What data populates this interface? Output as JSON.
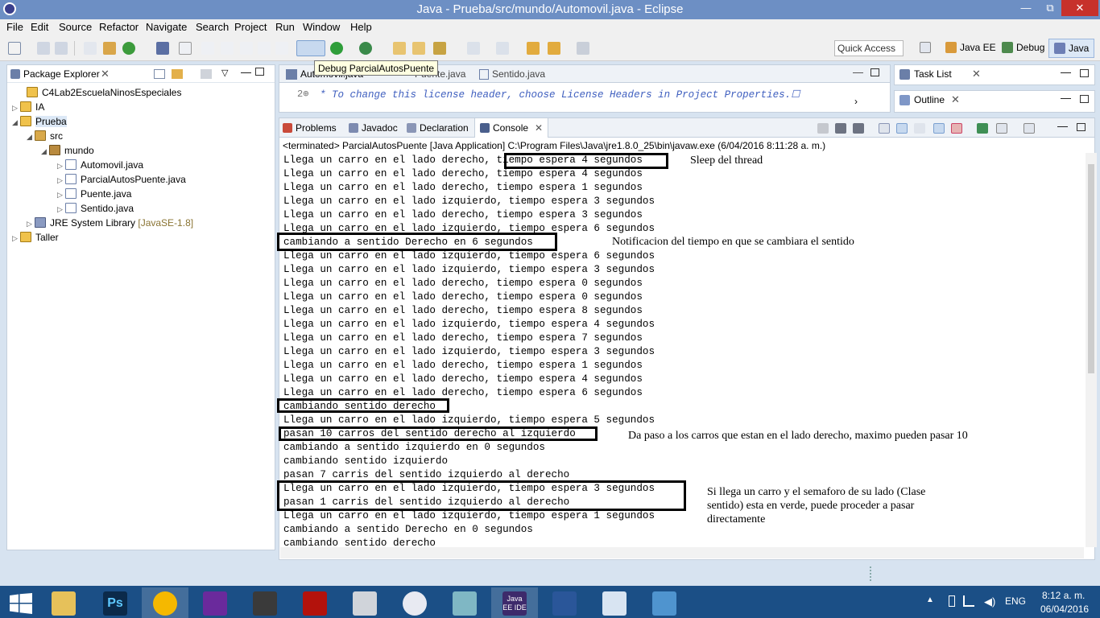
{
  "window": {
    "title": "Java - Prueba/src/mundo/Automovil.java - Eclipse",
    "min": "—",
    "max": "⧉",
    "close": "✕"
  },
  "menu": [
    "File",
    "Edit",
    "Source",
    "Refactor",
    "Navigate",
    "Search",
    "Project",
    "Run",
    "Window",
    "Help"
  ],
  "toolbar": {
    "quick_access": "Quick Access",
    "tooltip": "Debug ParcialAutosPuente",
    "perspectives": [
      "Java EE",
      "Debug",
      "Java"
    ]
  },
  "package_explorer": {
    "title": "Package Explorer",
    "items": [
      {
        "label": "C4Lab2EscuelaNinosEspeciales",
        "icon": "project-icon"
      },
      {
        "label": "IA",
        "icon": "project-icon"
      },
      {
        "label": "Prueba",
        "icon": "project-icon"
      },
      {
        "label": "src",
        "icon": "source-folder-icon"
      },
      {
        "label": "mundo",
        "icon": "package-icon"
      },
      {
        "label": "Automovil.java",
        "icon": "java-file-icon"
      },
      {
        "label": "ParcialAutosPuente.java",
        "icon": "java-file-icon"
      },
      {
        "label": "Puente.java",
        "icon": "java-file-icon"
      },
      {
        "label": "Sentido.java",
        "icon": "java-file-icon"
      },
      {
        "label": "JRE System Library",
        "icon": "library-icon",
        "extra": "[JavaSE-1.8]"
      },
      {
        "label": "Taller",
        "icon": "project-icon"
      }
    ]
  },
  "editor": {
    "tabs": [
      "Automovil.java",
      "Puente.java",
      "Sentido.java"
    ],
    "line_number": "2⊕",
    "code_line": "* To change this license header, choose License Headers in Project Properties.☐"
  },
  "side_views": {
    "task_list": "Task List",
    "outline": "Outline"
  },
  "console_view": {
    "tabs": [
      "Problems",
      "Javadoc",
      "Declaration",
      "Console"
    ],
    "terminated": "<terminated> ParcialAutosPuente [Java Application] C:\\Program Files\\Java\\jre1.8.0_25\\bin\\javaw.exe (6/04/2016 8:11:28 a. m.)",
    "lines": [
      "Llega un carro en el lado derecho, tiempo espera 4 segundos",
      "Llega un carro en el lado derecho, tiempo espera 4 segundos",
      "Llega un carro en el lado derecho, tiempo espera 1 segundos",
      "Llega un carro en el lado izquierdo, tiempo espera 3 segundos",
      "Llega un carro en el lado derecho, tiempo espera 3 segundos",
      "Llega un carro en el lado izquierdo, tiempo espera 6 segundos",
      "cambiando a sentido Derecho en 6 segundos",
      "Llega un carro en el lado izquierdo, tiempo espera 6 segundos",
      "Llega un carro en el lado izquierdo, tiempo espera 3 segundos",
      "Llega un carro en el lado derecho, tiempo espera 0 segundos",
      "Llega un carro en el lado derecho, tiempo espera 0 segundos",
      "Llega un carro en el lado derecho, tiempo espera 8 segundos",
      "Llega un carro en el lado izquierdo, tiempo espera 4 segundos",
      "Llega un carro en el lado derecho, tiempo espera 7 segundos",
      "Llega un carro en el lado izquierdo, tiempo espera 3 segundos",
      "Llega un carro en el lado derecho, tiempo espera 1 segundos",
      "Llega un carro en el lado derecho, tiempo espera 4 segundos",
      "Llega un carro en el lado derecho, tiempo espera 6 segundos",
      "cambiando sentido derecho",
      "Llega un carro en el lado izquierdo, tiempo espera 5 segundos",
      "pasan 10 carros del sentido derecho al izquierdo",
      "cambiando a sentido izquierdo en 0 segundos",
      "cambiando sentido izquierdo",
      "pasan 7 carris del sentido izquierdo al derecho",
      "Llega un carro en el lado izquierdo, tiempo espera 3 segundos",
      "pasan 1 carris del sentido izquierdo al derecho",
      "Llega un carro en el lado izquierdo, tiempo espera 1 segundos",
      "cambiando a sentido Derecho en 0 segundos",
      "cambiando sentido derecho"
    ],
    "annotations": {
      "sleep": "Sleep del thread",
      "notif": "Notificacion del tiempo en que se cambiara el sentido",
      "paso": "Da paso a los carros que estan en el lado derecho, maximo pueden pasar 10",
      "semaforo_1": "Si llega un carro y el semaforo de su lado (Clase",
      "semaforo_2": "sentido) esta en verde, puede proceder a pasar",
      "semaforo_3": "directamente"
    }
  },
  "taskbar": {
    "apps": [
      "start-icon",
      "file-explorer-icon",
      "photoshop-icon",
      "chrome-icon",
      "visual-studio-icon",
      "game-icon",
      "acrobat-icon",
      "calculator-icon",
      "itunes-icon",
      "notepad-icon",
      "eclipse-icon",
      "word-icon",
      "paint-icon",
      "photos-icon"
    ],
    "eclipse_label": "Java EE IDE",
    "language": "ENG",
    "time": "8:12 a. m.",
    "date": "06/04/2016"
  }
}
